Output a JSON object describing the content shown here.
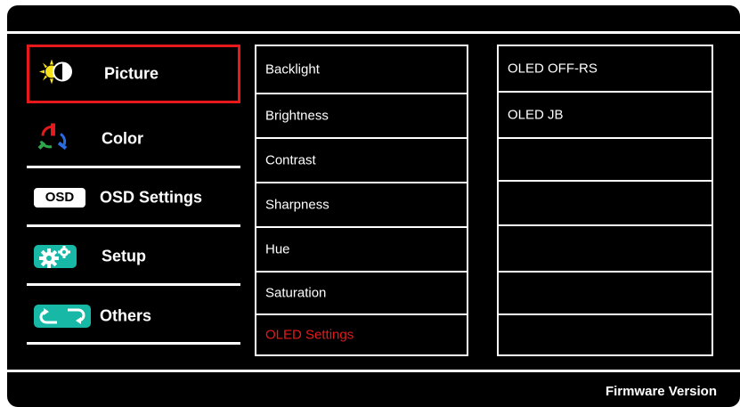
{
  "menu": {
    "items": [
      {
        "label": "Picture",
        "icon": "picture-icon",
        "selected": true
      },
      {
        "label": "Color",
        "icon": "color-icon"
      },
      {
        "label": "OSD Settings",
        "icon": "osd-icon",
        "icon_text": "OSD"
      },
      {
        "label": "Setup",
        "icon": "setup-gears-icon"
      },
      {
        "label": "Others",
        "icon": "others-arrows-icon"
      }
    ]
  },
  "submenu": {
    "items": [
      {
        "label": "Backlight"
      },
      {
        "label": "Brightness"
      },
      {
        "label": "Contrast"
      },
      {
        "label": "Sharpness"
      },
      {
        "label": "Hue"
      },
      {
        "label": "Saturation"
      },
      {
        "label": "OLED Settings",
        "highlighted": true
      }
    ]
  },
  "options": {
    "items": [
      {
        "label": "OLED OFF-RS"
      },
      {
        "label": "OLED JB"
      },
      {
        "label": ""
      },
      {
        "label": ""
      },
      {
        "label": ""
      },
      {
        "label": ""
      },
      {
        "label": ""
      }
    ]
  },
  "footer": {
    "label": "Firmware Version"
  },
  "colors": {
    "selected_border": "#e8191b",
    "highlight_text": "#e8191b",
    "background": "#000000",
    "accent_teal": "#17b9a6"
  }
}
